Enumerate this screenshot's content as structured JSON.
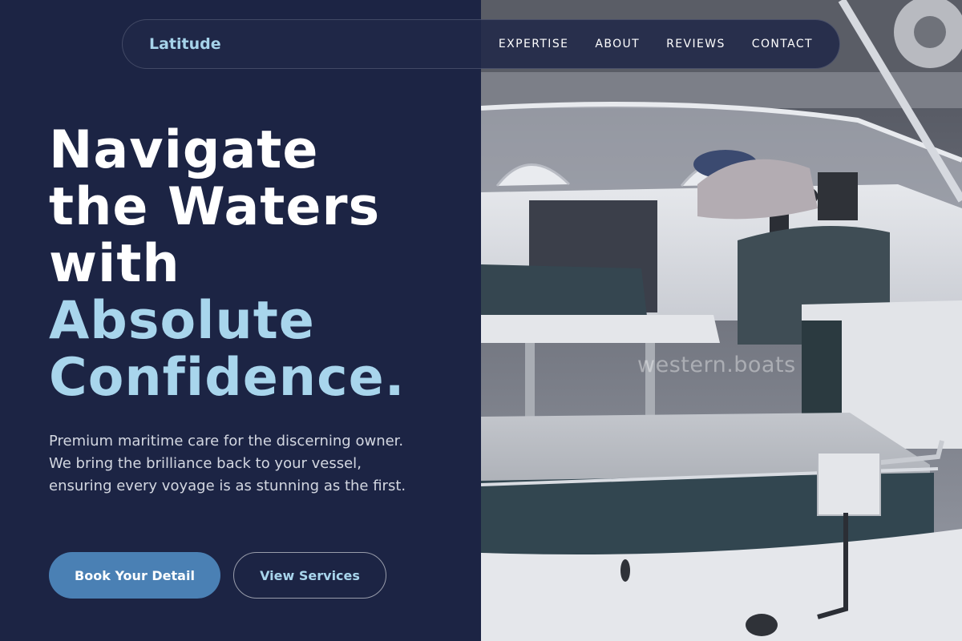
{
  "brand": {
    "logo": "Latitude"
  },
  "nav": {
    "items": [
      {
        "label": "EXPERTISE"
      },
      {
        "label": "ABOUT"
      },
      {
        "label": "REVIEWS"
      },
      {
        "label": "CONTACT"
      }
    ]
  },
  "hero": {
    "title_lines": [
      "Navigate",
      "the Waters",
      "with"
    ],
    "title_accent_lines": [
      "Absolute",
      "Confidence."
    ],
    "description": "Premium maritime care for the discerning owner. We bring the brilliance back to your vessel, ensuring every voyage is as stunning as the first.",
    "primary_button": "Book Your Detail",
    "secondary_button": "View Services"
  },
  "image": {
    "watermark": "western.boats"
  },
  "colors": {
    "background": "#1c2444",
    "accent": "#a8d5ec",
    "button_primary": "#4a80b4",
    "text": "#ffffff"
  }
}
